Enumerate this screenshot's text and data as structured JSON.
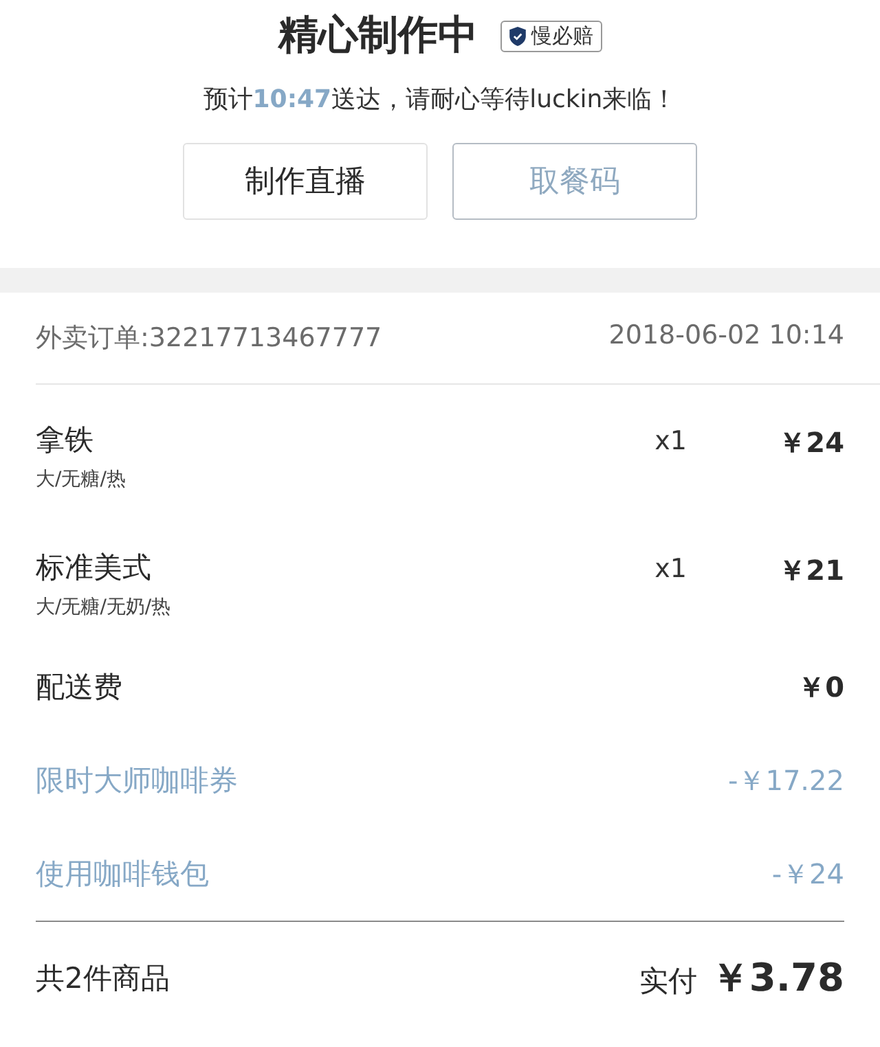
{
  "header": {
    "title": "精心制作中",
    "badge": "慢必赔",
    "subtitle": {
      "before": "预计",
      "time": "10:47",
      "after": "送达，请耐心等待luckin来临！"
    }
  },
  "buttons": [
    {
      "label": "制作直播",
      "kind": "plain"
    },
    {
      "label": "取餐码",
      "kind": "accent"
    }
  ],
  "order": {
    "number": "外卖订单:32217713467777",
    "time": "2018-06-02 10:14"
  },
  "items": [
    {
      "name": "拿铁",
      "options": "大/无糖/热",
      "quantity": "x1",
      "price": "￥24"
    },
    {
      "name": "标准美式",
      "options": "大/无糖/无奶/热",
      "quantity": "x1",
      "price": "￥21"
    }
  ],
  "charges": [
    {
      "label": "配送费",
      "amount": "￥0",
      "kind": "fee"
    },
    {
      "label": "限时大师咖啡券",
      "amount": "-￥17.22",
      "kind": "discount"
    },
    {
      "label": "使用咖啡钱包",
      "amount": "-￥24",
      "kind": "discount"
    }
  ],
  "summary": {
    "count": "共2件商品",
    "paid_label": "实付",
    "paid": "￥3.78"
  }
}
